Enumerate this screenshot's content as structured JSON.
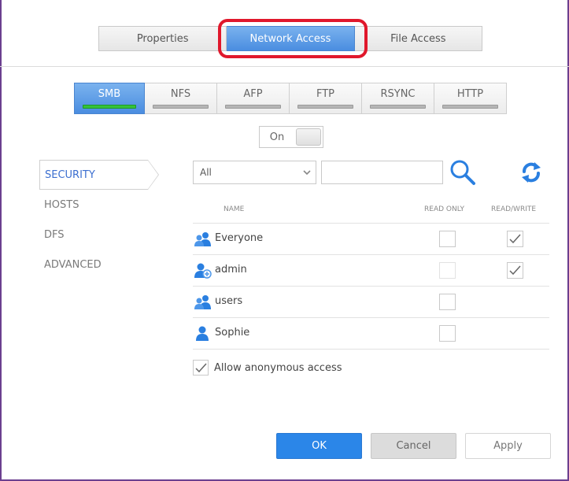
{
  "top_tabs": [
    {
      "label": "Properties",
      "active": false
    },
    {
      "label": "Network Access",
      "active": true
    },
    {
      "label": "File Access",
      "active": false
    }
  ],
  "protocol_tabs": [
    {
      "label": "SMB",
      "active": true,
      "enabled": true
    },
    {
      "label": "NFS",
      "active": false,
      "enabled": false
    },
    {
      "label": "AFP",
      "active": false,
      "enabled": false
    },
    {
      "label": "FTP",
      "active": false,
      "enabled": false
    },
    {
      "label": "RSYNC",
      "active": false,
      "enabled": false
    },
    {
      "label": "HTTP",
      "active": false,
      "enabled": false
    }
  ],
  "toggle": {
    "label": "On"
  },
  "side_nav": [
    {
      "label": "SECURITY",
      "active": true
    },
    {
      "label": "HOSTS",
      "active": false
    },
    {
      "label": "DFS",
      "active": false
    },
    {
      "label": "ADVANCED",
      "active": false
    }
  ],
  "filter": {
    "selected": "All",
    "search_value": "",
    "search_placeholder": ""
  },
  "table": {
    "headers": {
      "name": "NAME",
      "read_only": "READ ONLY",
      "read_write": "READ/WRITE"
    },
    "rows": [
      {
        "name": "Everyone",
        "icon": "group-icon",
        "read_only": false,
        "read_write": true
      },
      {
        "name": "admin",
        "icon": "admin-user-icon",
        "read_only": false,
        "read_write": true
      },
      {
        "name": "users",
        "icon": "group-icon",
        "read_only": false,
        "read_write": null
      },
      {
        "name": "Sophie",
        "icon": "user-icon",
        "read_only": false,
        "read_write": null
      }
    ]
  },
  "anonymous": {
    "label": "Allow anonymous access",
    "checked": true
  },
  "buttons": {
    "ok": "OK",
    "cancel": "Cancel",
    "apply": "Apply"
  },
  "colors": {
    "accent": "#4a8de0",
    "highlight_ring": "#e0182c",
    "active_indicator": "#34c23a",
    "primary_button": "#2b86e8",
    "frame": "#6b3f8f"
  }
}
